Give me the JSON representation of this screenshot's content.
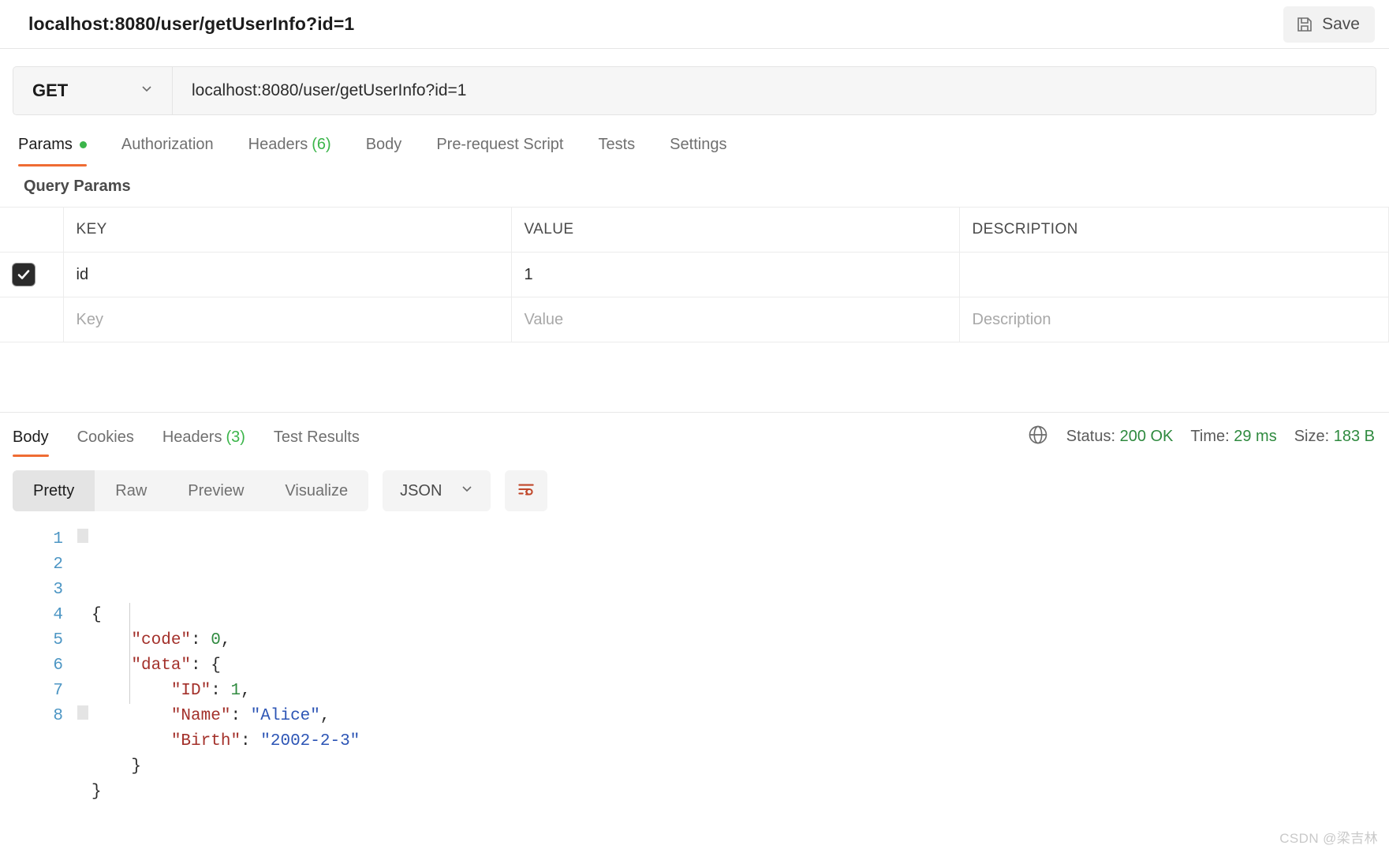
{
  "topbar": {
    "request_title": "localhost:8080/user/getUserInfo?id=1",
    "save_label": "Save",
    "save_icon": "floppy-disk-icon"
  },
  "url_row": {
    "method": "GET",
    "method_chevron": "chevron-down-icon",
    "url": "localhost:8080/user/getUserInfo?id=1"
  },
  "request_tabs": [
    {
      "label": "Params",
      "active": true,
      "dot": true
    },
    {
      "label": "Authorization",
      "active": false
    },
    {
      "label": "Headers",
      "active": false,
      "count": "(6)"
    },
    {
      "label": "Body",
      "active": false
    },
    {
      "label": "Pre-request Script",
      "active": false
    },
    {
      "label": "Tests",
      "active": false
    },
    {
      "label": "Settings",
      "active": false
    }
  ],
  "query_params": {
    "section_title": "Query Params",
    "columns": [
      "KEY",
      "VALUE",
      "DESCRIPTION"
    ],
    "rows": [
      {
        "checked": true,
        "key": "id",
        "value": "1",
        "description": ""
      }
    ],
    "placeholder_row": {
      "key": "Key",
      "value": "Value",
      "description": "Description"
    }
  },
  "response_tabs": [
    {
      "label": "Body",
      "active": true
    },
    {
      "label": "Cookies",
      "active": false
    },
    {
      "label": "Headers",
      "active": false,
      "count": "(3)"
    },
    {
      "label": "Test Results",
      "active": false
    }
  ],
  "response_meta": {
    "globe_icon": "globe-icon",
    "status_label": "Status:",
    "status_value": "200 OK",
    "time_label": "Time:",
    "time_value": "29 ms",
    "size_label": "Size:",
    "size_value": "183 B",
    "ok_color": "#2f8a3f"
  },
  "body_toolbar": {
    "views": [
      {
        "label": "Pretty",
        "active": true
      },
      {
        "label": "Raw",
        "active": false
      },
      {
        "label": "Preview",
        "active": false
      },
      {
        "label": "Visualize",
        "active": false
      }
    ],
    "format": "JSON",
    "format_chevron": "chevron-down-icon",
    "wrap_button_icon": "wrap-lines-icon",
    "accent_color": "#c0472a"
  },
  "code": {
    "line_numbers": [
      "1",
      "2",
      "3",
      "4",
      "5",
      "6",
      "7",
      "8"
    ],
    "lines": [
      [
        {
          "t": "{",
          "c": "p"
        }
      ],
      [
        {
          "t": "    ",
          "c": "p"
        },
        {
          "t": "\"code\"",
          "c": "k"
        },
        {
          "t": ": ",
          "c": "p"
        },
        {
          "t": "0",
          "c": "n"
        },
        {
          "t": ",",
          "c": "p"
        }
      ],
      [
        {
          "t": "    ",
          "c": "p"
        },
        {
          "t": "\"data\"",
          "c": "k"
        },
        {
          "t": ": ",
          "c": "p"
        },
        {
          "t": "{",
          "c": "p"
        }
      ],
      [
        {
          "t": "        ",
          "c": "p"
        },
        {
          "t": "\"ID\"",
          "c": "k"
        },
        {
          "t": ": ",
          "c": "p"
        },
        {
          "t": "1",
          "c": "n"
        },
        {
          "t": ",",
          "c": "p"
        }
      ],
      [
        {
          "t": "        ",
          "c": "p"
        },
        {
          "t": "\"Name\"",
          "c": "k"
        },
        {
          "t": ": ",
          "c": "p"
        },
        {
          "t": "\"Alice\"",
          "c": "s"
        },
        {
          "t": ",",
          "c": "p"
        }
      ],
      [
        {
          "t": "        ",
          "c": "p"
        },
        {
          "t": "\"Birth\"",
          "c": "k"
        },
        {
          "t": ": ",
          "c": "p"
        },
        {
          "t": "\"2002-2-3\"",
          "c": "s"
        }
      ],
      [
        {
          "t": "    ",
          "c": "p"
        },
        {
          "t": "}",
          "c": "p"
        }
      ],
      [
        {
          "t": "}",
          "c": "p"
        }
      ]
    ]
  },
  "watermark": "CSDN @梁吉林"
}
